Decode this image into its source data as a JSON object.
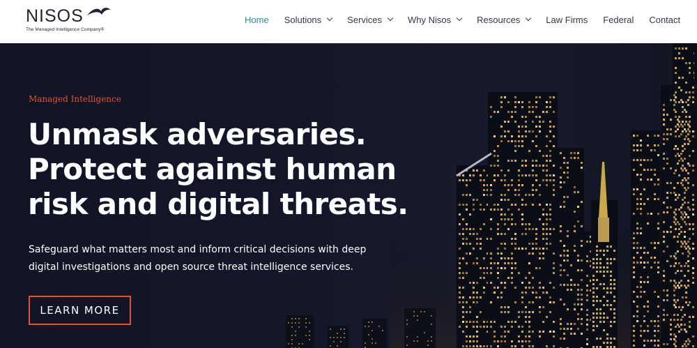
{
  "logo": {
    "wordmark": "NISOS",
    "tagline": "The Managed Intelligence Company®"
  },
  "nav": {
    "items": [
      {
        "label": "Home",
        "active": true,
        "dropdown": false
      },
      {
        "label": "Solutions",
        "active": false,
        "dropdown": true
      },
      {
        "label": "Services",
        "active": false,
        "dropdown": true
      },
      {
        "label": "Why Nisos",
        "active": false,
        "dropdown": true
      },
      {
        "label": "Resources",
        "active": false,
        "dropdown": true
      },
      {
        "label": "Law Firms",
        "active": false,
        "dropdown": false
      },
      {
        "label": "Federal",
        "active": false,
        "dropdown": false
      },
      {
        "label": "Contact",
        "active": false,
        "dropdown": false
      }
    ],
    "search_icon": "search-icon"
  },
  "hero": {
    "eyebrow": "Managed Intelligence",
    "headline": "Unmask adversaries. Protect against human risk and digital threats.",
    "subtext": "Safeguard what matters most and inform critical decisions with deep digital investigations and open source threat intelligence services.",
    "cta_label": "LEARN MORE"
  },
  "colors": {
    "accent": "#e0533a",
    "active_nav": "#2e8c99",
    "hero_bg": "#131729",
    "text_dark": "#33384a"
  }
}
